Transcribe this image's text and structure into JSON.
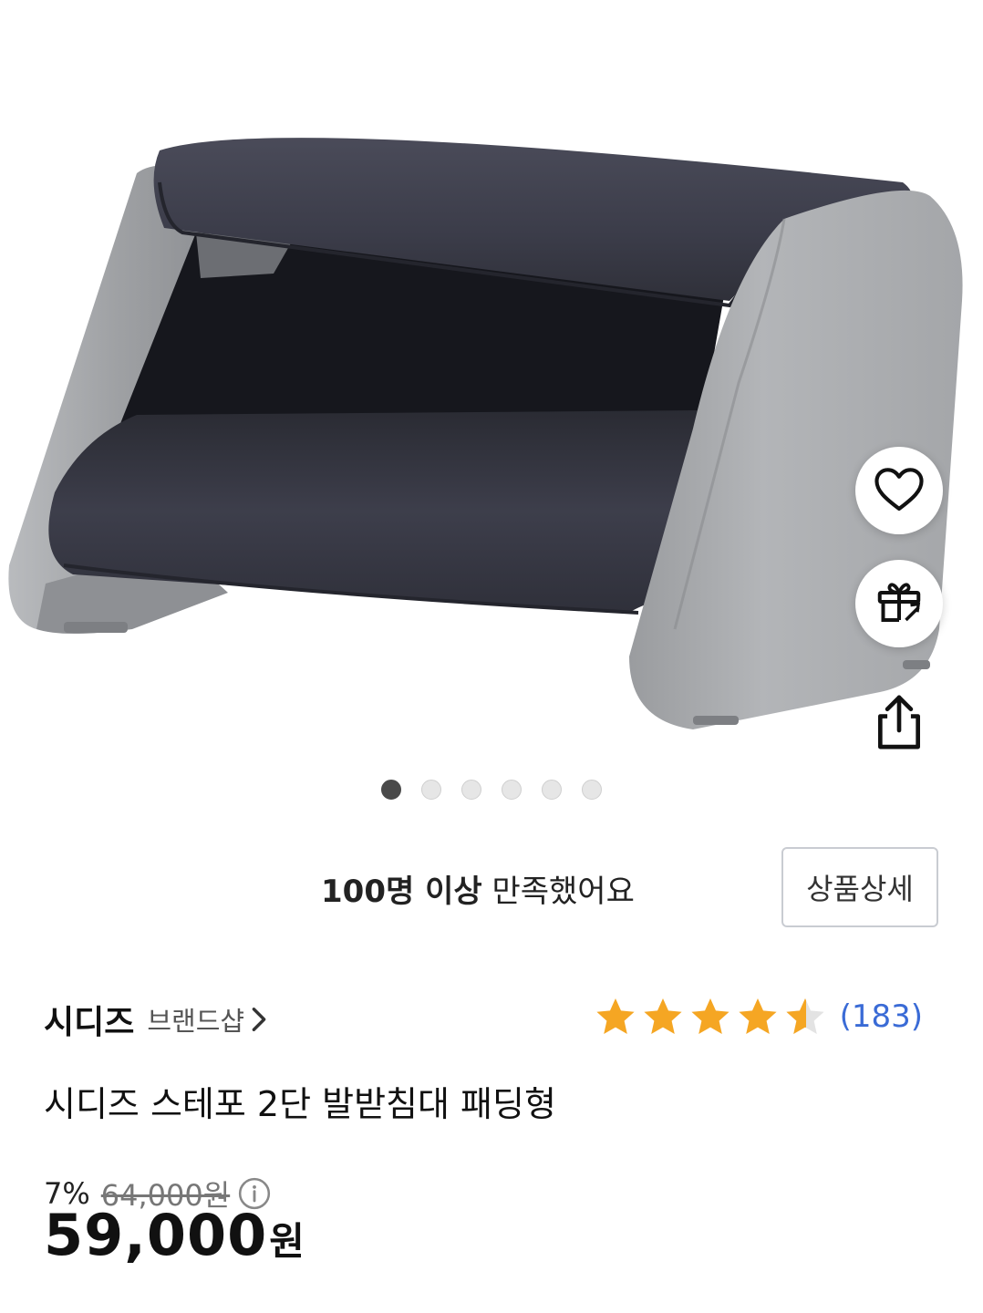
{
  "product": {
    "image_alt": "",
    "gallery_count": 6,
    "gallery_active": 1
  },
  "satisfaction": {
    "bold": "100명 이상",
    "rest": "만족했어요"
  },
  "detail_button": "상품상세",
  "brand": {
    "name": "시디즈",
    "shop_link": "브랜드샵"
  },
  "rating": {
    "score": 4.6,
    "max": 5,
    "count": "(183)"
  },
  "title": "시디즈 스테포 2단 발받침대 패딩형",
  "price": {
    "discount": "7%",
    "original": "64,000원",
    "current": "59,000",
    "currency": "원"
  },
  "icons": {
    "wishlist": "heart-icon",
    "gift": "gift-icon",
    "share": "share-icon",
    "info": "info-icon",
    "brand_arrow": "chevron-right-icon",
    "star": "star-icon"
  },
  "colors": {
    "star": "#F5A623",
    "review_count": "#3A6BD6",
    "fabric": "#3A3B48",
    "frame": "#9EA0A3"
  }
}
